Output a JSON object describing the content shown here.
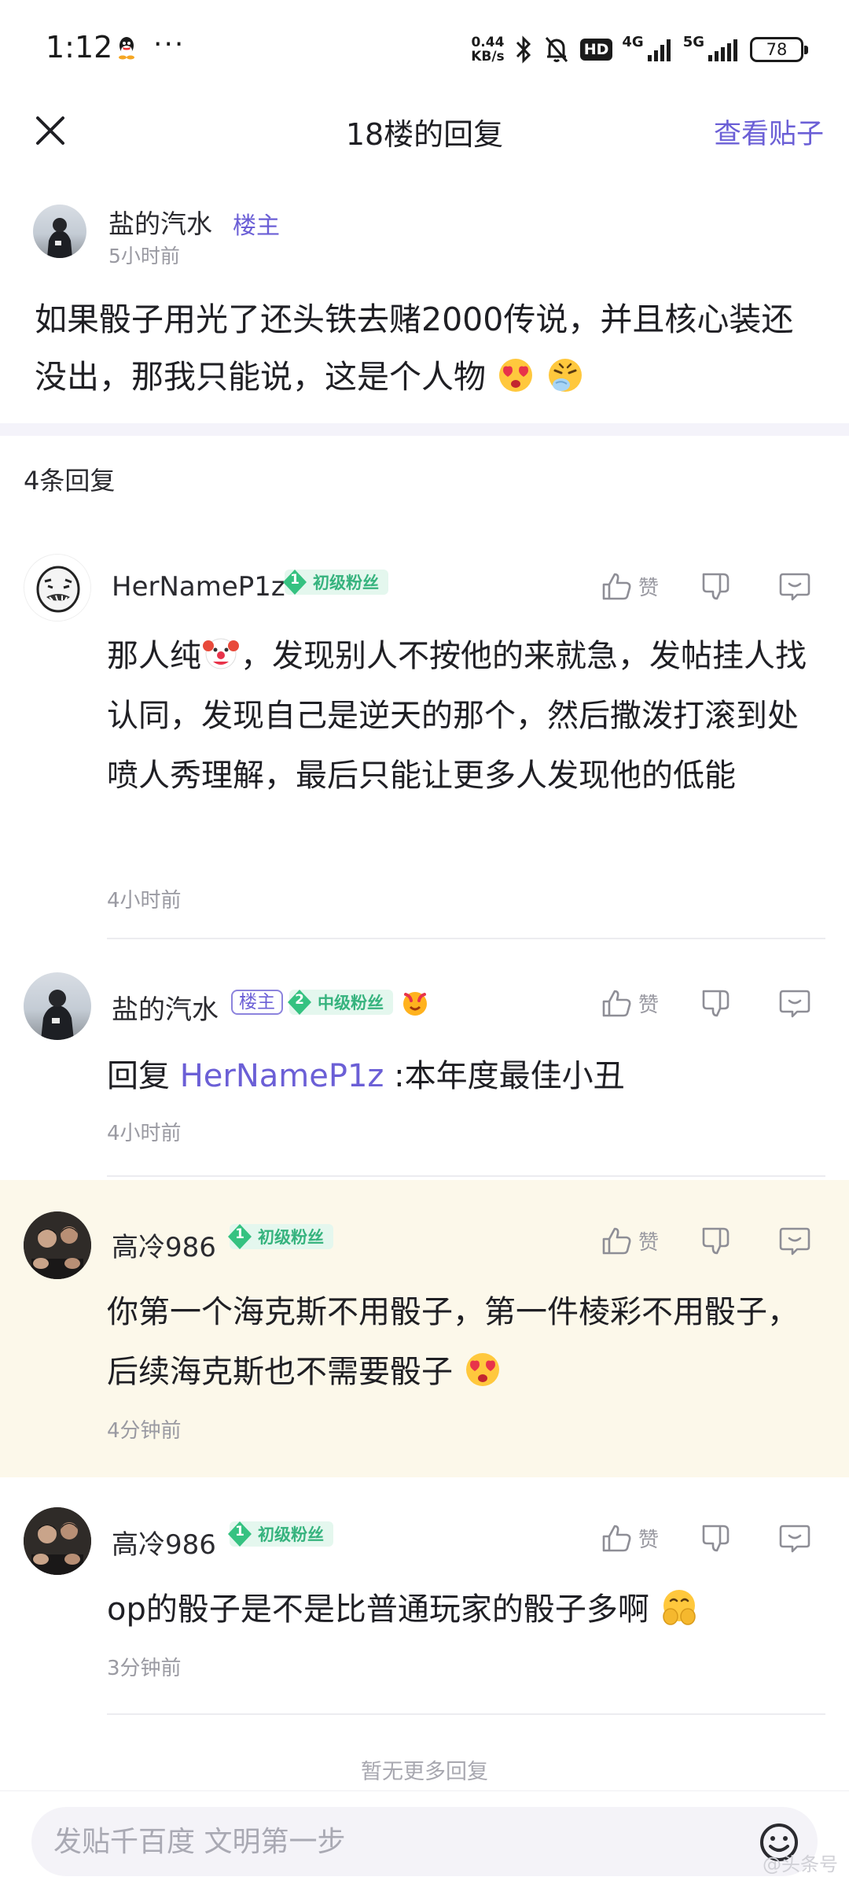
{
  "status_bar": {
    "time": "1:12",
    "speed_value": "0.44",
    "speed_unit": "KB/s",
    "hd": "HD",
    "net1": "4G",
    "net2": "5G",
    "battery": "78"
  },
  "header": {
    "title": "18楼的回复",
    "view_post": "查看贴子"
  },
  "original_post": {
    "author": "盐的汽水",
    "badge": "楼主",
    "time": "5小时前",
    "content": "如果骰子用光了还头铁去赌2000传说，并且核心装还没出，那我只能说，这是个人物"
  },
  "reply_count": "4条回复",
  "like_label": "赞",
  "replies": [
    {
      "name": "HerNameP1z",
      "fan_level": "1",
      "fan_label": "初级粉丝",
      "content_pre": "那人纯",
      "content_post": "，发现别人不按他的来就急，发帖挂人找认同，发现自己是逆天的那个，然后撒泼打滚到处喷人秀理解，最后只能让更多人发现他的低能",
      "time": "4小时前"
    },
    {
      "name": "盐的汽水",
      "lz": "楼主",
      "fan_level": "2",
      "fan_label": "中级粉丝",
      "reply_prefix": "回复",
      "mention": "HerNameP1z",
      "content": " :本年度最佳小丑",
      "time": "4小时前"
    },
    {
      "name": "高冷986",
      "fan_level": "1",
      "fan_label": "初级粉丝",
      "content": "你第一个海克斯不用骰子，第一件棱彩不用骰子，后续海克斯也不需要骰子",
      "time": "4分钟前"
    },
    {
      "name": "高冷986",
      "fan_level": "1",
      "fan_label": "初级粉丝",
      "content": "op的骰子是不是比普通玩家的骰子多啊",
      "time": "3分钟前"
    }
  ],
  "no_more": "暂无更多回复",
  "input": {
    "placeholder": "发贴千百度 文明第一步"
  },
  "watermark": "@头条号"
}
